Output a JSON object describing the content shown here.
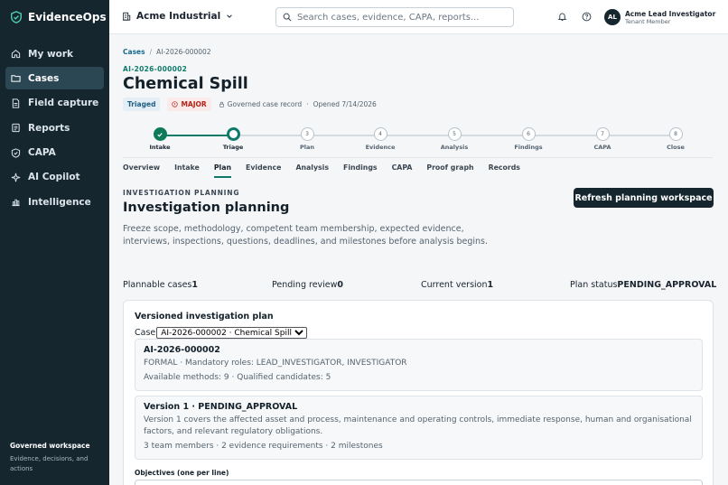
{
  "brand": {
    "name": "EvidenceOps"
  },
  "sidebar": {
    "items": [
      {
        "label": "My work",
        "icon": "home-icon"
      },
      {
        "label": "Cases",
        "icon": "folder-icon",
        "active": true
      },
      {
        "label": "Field capture",
        "icon": "file-icon"
      },
      {
        "label": "Reports",
        "icon": "report-icon"
      },
      {
        "label": "CAPA",
        "icon": "shield-check-icon"
      },
      {
        "label": "AI Copilot",
        "icon": "sparkle-icon"
      },
      {
        "label": "Intelligence",
        "icon": "bar-chart-icon"
      }
    ],
    "footer_title": "Governed workspace",
    "footer_desc": "Evidence, decisions, and actions"
  },
  "header": {
    "org_name": "Acme Industrial",
    "search_placeholder": "Search cases, evidence, CAPA, reports...",
    "user_initials": "AL",
    "user_name": "Acme Lead Investigator",
    "user_role": "Tenant Member"
  },
  "breadcrumb": {
    "root": "Cases",
    "sep": "/",
    "current": "AI-2026-000002"
  },
  "case": {
    "id": "AI-2026-000002",
    "title": "Chemical Spill",
    "status_badge": "Triaged",
    "severity_badge": "MAJOR",
    "record_type": "Governed case record",
    "meta_sep": "·",
    "opened": "Opened 7/14/2026"
  },
  "stepper": [
    {
      "num": "1",
      "label": "Intake",
      "state": "done"
    },
    {
      "num": "2",
      "label": "Triage",
      "state": "current"
    },
    {
      "num": "3",
      "label": "Plan",
      "state": "todo"
    },
    {
      "num": "4",
      "label": "Evidence",
      "state": "todo"
    },
    {
      "num": "5",
      "label": "Analysis",
      "state": "todo"
    },
    {
      "num": "6",
      "label": "Findings",
      "state": "todo"
    },
    {
      "num": "7",
      "label": "CAPA",
      "state": "todo"
    },
    {
      "num": "8",
      "label": "Close",
      "state": "todo"
    }
  ],
  "tabs": [
    {
      "label": "Overview"
    },
    {
      "label": "Intake"
    },
    {
      "label": "Plan",
      "active": true
    },
    {
      "label": "Evidence"
    },
    {
      "label": "Analysis"
    },
    {
      "label": "Findings"
    },
    {
      "label": "CAPA"
    },
    {
      "label": "Proof graph"
    },
    {
      "label": "Records"
    }
  ],
  "planning": {
    "eyebrow": "INVESTIGATION PLANNING",
    "title": "Investigation planning",
    "description": "Freeze scope, methodology, competent team membership, expected evidence, interviews, inspections, questions, deadlines, and milestones before analysis begins.",
    "refresh_button": "Refresh planning workspace"
  },
  "stats": [
    {
      "label": "Plannable cases",
      "value": "1"
    },
    {
      "label": "Pending review",
      "value": "0"
    },
    {
      "label": "Current version",
      "value": "1"
    },
    {
      "label": "Plan status",
      "value": "PENDING_APPROVAL"
    }
  ],
  "plan_card": {
    "title": "Versioned investigation plan",
    "case_label": "Case",
    "case_selected": "AI-2026-000002 · Chemical Spill",
    "case_summary": {
      "heading": "AI-2026-000002",
      "line1": "FORMAL · Mandatory roles: LEAD_INVESTIGATOR, INVESTIGATOR",
      "line2": "Available methods: 9 · Qualified candidates: 5"
    },
    "version": {
      "heading": "Version 1 · PENDING_APPROVAL",
      "line1": "Version 1 covers the affected asset and process, maintenance and operating controls, immediate response, human and organisational factors, and relevant regulatory obligations.",
      "line2": "3 team members · 2 evidence requirements · 2 milestones"
    },
    "objectives_label": "Objectives (one per line)"
  }
}
